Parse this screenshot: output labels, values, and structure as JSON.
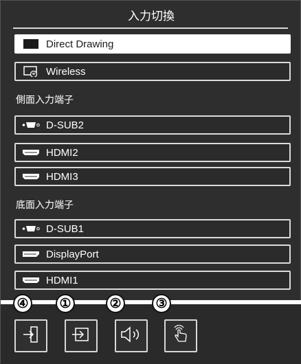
{
  "title": "入力切換",
  "items": {
    "direct_drawing": "Direct Drawing",
    "wireless": "Wireless",
    "side_dsub2": "D-SUB2",
    "side_hdmi2": "HDMI2",
    "side_hdmi3": "HDMI3",
    "bottom_dsub1": "D-SUB1",
    "bottom_displayport": "DisplayPort",
    "bottom_hdmi1": "HDMI1"
  },
  "sections": {
    "side": "側面入力端子",
    "bottom": "底面入力端子"
  },
  "badges": [
    "④",
    "①",
    "②",
    "③"
  ],
  "icons": {
    "toolbar": [
      "exit-icon",
      "input-switch-icon",
      "volume-icon",
      "touch-icon"
    ],
    "items": [
      "screen-icon",
      "wireless-icon",
      "vga-icon",
      "hdmi-icon",
      "hdmi-icon",
      "vga-icon",
      "displayport-icon",
      "hdmi-icon"
    ]
  },
  "colors": {
    "background": "#2e2e2e",
    "accent": "#ffffff",
    "border": "#dcdcdc"
  }
}
